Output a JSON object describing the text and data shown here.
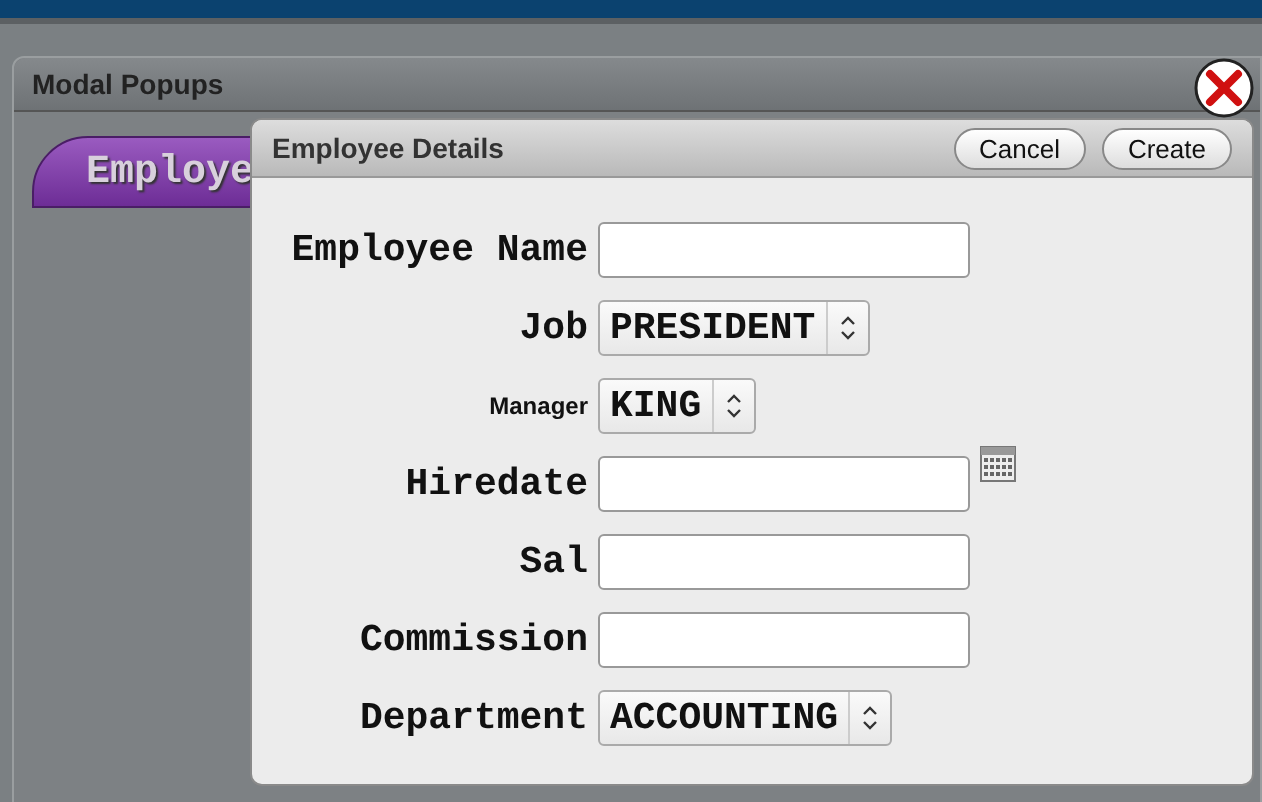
{
  "panel": {
    "title": "Modal Popups"
  },
  "tab": {
    "label": "Employe"
  },
  "dialog": {
    "title": "Employee Details",
    "buttons": [
      "Cancel",
      "Create"
    ],
    "fields": [
      {
        "kind": "text",
        "label": "Employee Name",
        "small_label": false
      },
      {
        "kind": "select",
        "label": "Job",
        "value": "PRESIDENT",
        "small_label": false
      },
      {
        "kind": "select",
        "label": "Manager",
        "value": "KING",
        "small_label": true
      },
      {
        "kind": "date",
        "label": "Hiredate",
        "small_label": false
      },
      {
        "kind": "text",
        "label": "Sal",
        "small_label": false
      },
      {
        "kind": "text",
        "label": "Commission",
        "small_label": false
      },
      {
        "kind": "select",
        "label": "Department",
        "value": "ACCOUNTING",
        "small_label": false
      }
    ]
  }
}
